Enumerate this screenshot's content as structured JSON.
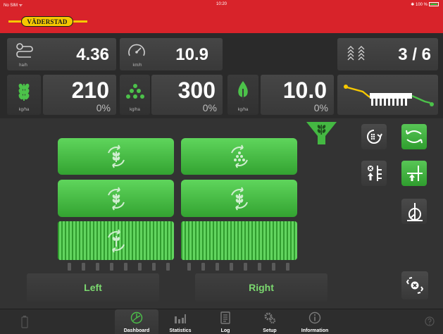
{
  "status": {
    "carrier": "No SIM ᯤ",
    "time": "10:20",
    "battery": "✱ 100 %"
  },
  "brand": {
    "name": "VÄDERSTAD",
    "color": "#f6c800",
    "bar_color": "#d8232a"
  },
  "metrics": {
    "area_rate": {
      "value": "4.36",
      "unit": "ha/h",
      "icon": "area-per-hour-icon"
    },
    "speed": {
      "value": "10.9",
      "unit": "km/h",
      "icon": "speedometer-icon"
    },
    "tramline": {
      "value": "3 / 6",
      "icon": "tramline-icon"
    }
  },
  "rates": [
    {
      "value": "210",
      "unit": "kg/ha",
      "percent": "0%",
      "icon": "grain-seed-icon"
    },
    {
      "value": "300",
      "unit": "kg/ha",
      "percent": "0%",
      "icon": "fertilizer-dots-icon"
    },
    {
      "value": "10.0",
      "unit": "kg/ha",
      "percent": "0%",
      "icon": "leaf-drop-icon"
    }
  ],
  "sections": {
    "left": "Left",
    "right": "Right"
  },
  "nav": [
    {
      "label": "Dashboard",
      "icon": "dashboard-icon",
      "active": true
    },
    {
      "label": "Statistics",
      "icon": "statistics-icon",
      "active": false
    },
    {
      "label": "Log",
      "icon": "log-icon",
      "active": false
    },
    {
      "label": "Setup",
      "icon": "gears-icon",
      "active": false
    },
    {
      "label": "Information",
      "icon": "info-icon",
      "active": false
    }
  ],
  "colors": {
    "accent_green": "#4cc24a",
    "tile": "#434343",
    "background": "#2a2a2a"
  }
}
